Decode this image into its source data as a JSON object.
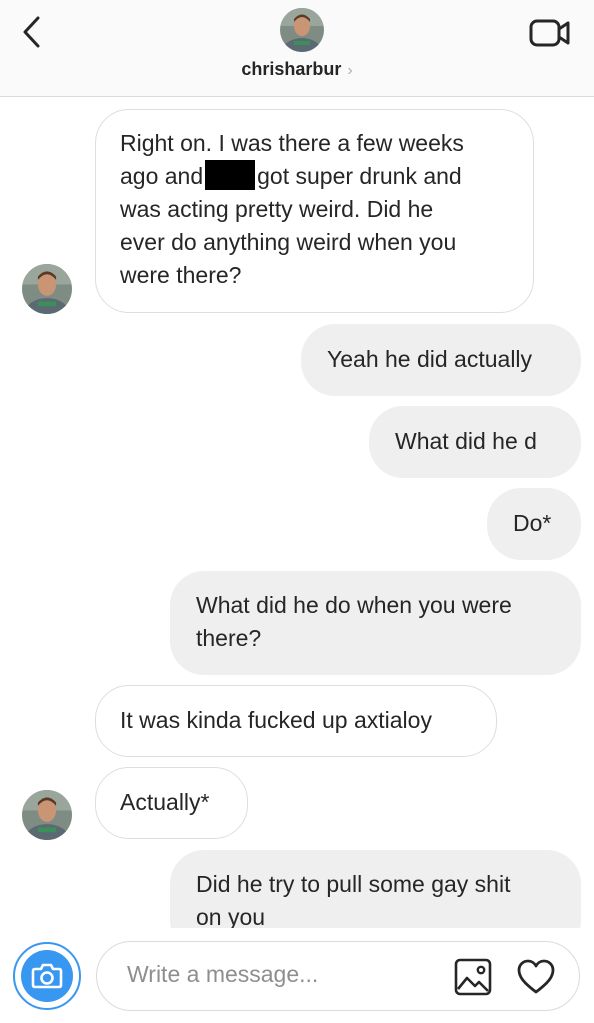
{
  "header": {
    "username": "chrisharbur",
    "chevron": "›"
  },
  "messages": [
    {
      "side": "in",
      "lines": [
        "Right on. I was there a few weeks",
        "ago and",
        "got super drunk and",
        "was acting pretty weird. Did he",
        "ever do anything weird when you",
        "were there?"
      ]
    },
    {
      "side": "out",
      "text": "Yeah he did actually"
    },
    {
      "side": "out",
      "text": "What did he d"
    },
    {
      "side": "out",
      "text": "Do*"
    },
    {
      "side": "out",
      "lines": [
        "What did he do when you were",
        "there?"
      ]
    },
    {
      "side": "in",
      "text": "It was kinda fucked up axtialoy"
    },
    {
      "side": "in",
      "text": "Actually*"
    },
    {
      "side": "out",
      "lines": [
        "Did he try to pull some gay shit",
        "on you"
      ]
    }
  ],
  "composer": {
    "placeholder": "Write a message..."
  },
  "colors": {
    "accent": "#3897f0",
    "incoming_bg": "#ffffff",
    "outgoing_bg": "#efefef"
  }
}
